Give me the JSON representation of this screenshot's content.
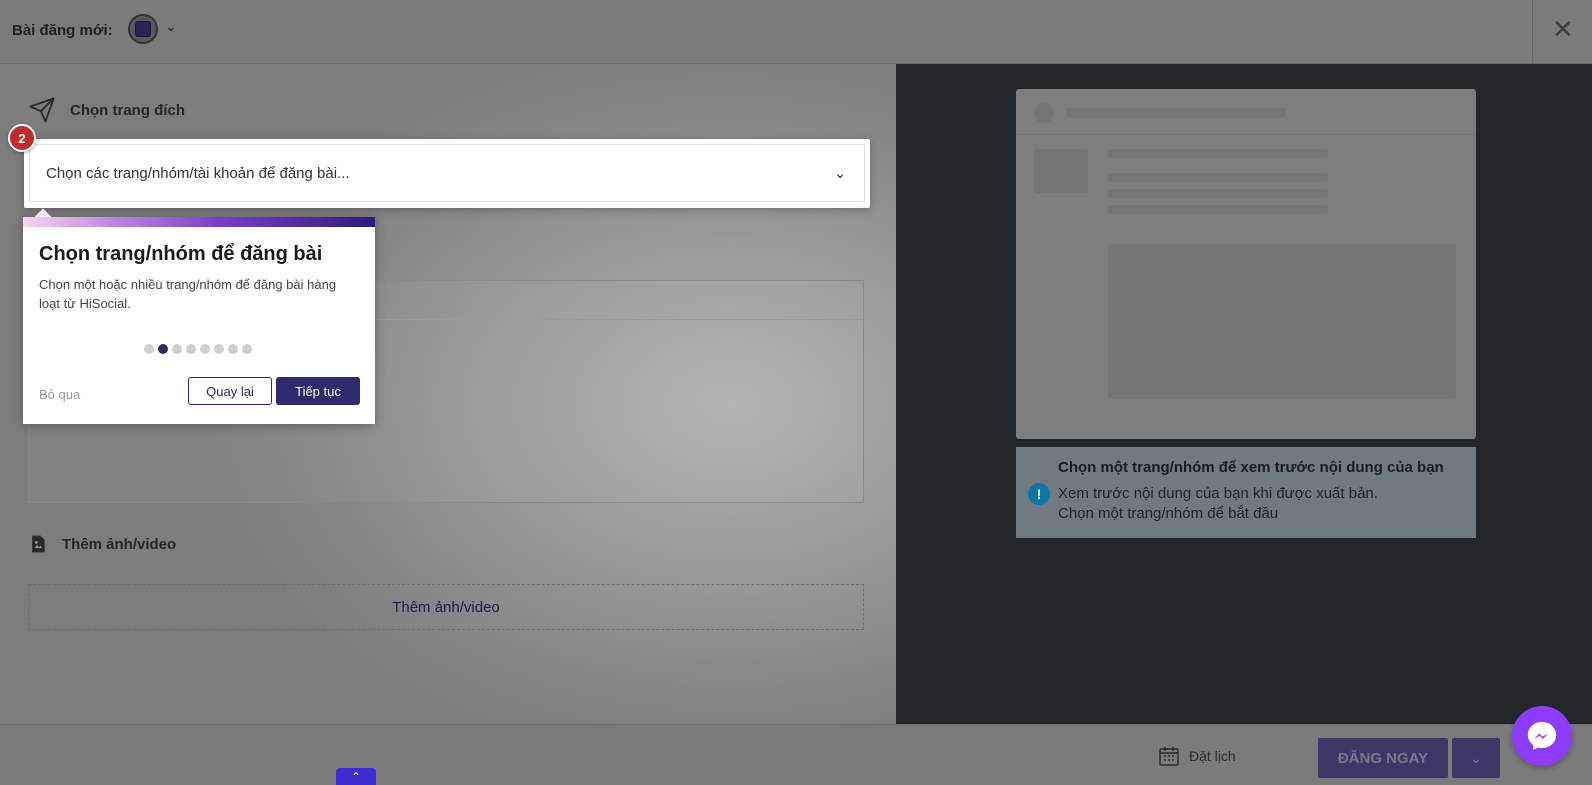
{
  "header": {
    "title": "Bài đăng mới:",
    "avatar_icon": "page-avatar",
    "chevron_icon": "chevron-down-icon",
    "close_icon": "close-icon"
  },
  "left": {
    "target_label": "Chọn trang đích",
    "select_placeholder": "Chọn các trang/nhóm/tài khoản để đăng bài...",
    "step_number": "2",
    "media_label": "Thêm ảnh/video",
    "media_button": "Thêm ảnh/video"
  },
  "tour": {
    "title": "Chọn trang/nhóm để đăng bài",
    "body": "Chọn một hoặc nhiều trang/nhóm để đăng bài hàng loạt từ HiSocial.",
    "step_count": 8,
    "active_step": 2,
    "skip": "Bỏ qua",
    "back": "Quay lại",
    "next": "Tiếp tục"
  },
  "preview": {
    "info_title": "Chọn một trang/nhóm để xem trước nội dung của bạn",
    "info_line1": "Xem trước nội dung của bạn khi được xuất bản.",
    "info_line2": "Chọn một trang/nhóm để bắt đầu"
  },
  "footer": {
    "schedule": "Đặt lịch",
    "post_now": "ĐĂNG NGAY"
  },
  "colors": {
    "brand": "#2f2a6e",
    "badge": "#c22b2b",
    "info_icon": "#0b76a8",
    "messenger": "#8e3cff"
  }
}
